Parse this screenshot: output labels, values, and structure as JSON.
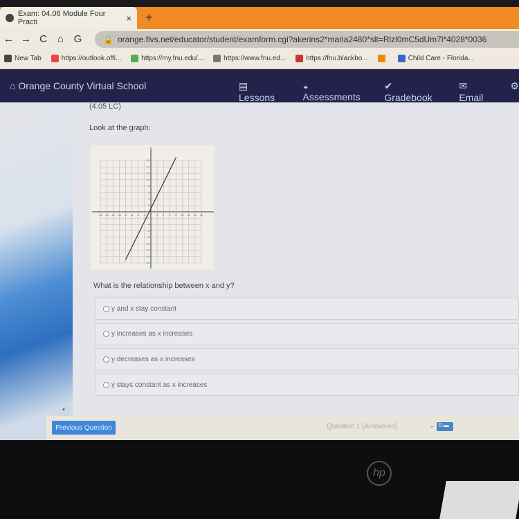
{
  "browser": {
    "tab_title": "Exam: 04.06 Module Four Practi",
    "new_tab": "+",
    "close": "×",
    "url": "orange.flvs.net/educator/student/examform.cgi?akerins2*maria2480*slt=Rlzl0mC5dUm7l*4028*0036",
    "bookmarks": [
      {
        "label": "New Tab",
        "color": "#444"
      },
      {
        "label": "https://outlook.offi...",
        "color": "#e44"
      },
      {
        "label": "https://my.fnu.edu/...",
        "color": "#5a5"
      },
      {
        "label": "https://www.fnu.ed...",
        "color": "#777"
      },
      {
        "label": "https://fnu.blackbo...",
        "color": "#c33"
      },
      {
        "label": "",
        "color": "#e80"
      },
      {
        "label": "Child Care - Florida...",
        "color": "#36c"
      }
    ]
  },
  "nav": {
    "brand": "⌂ Orange County Virtual School",
    "items": [
      "▤ Lessons",
      "◒ Assessments",
      "✔ Gradebook",
      "✉ Email",
      "⚙"
    ]
  },
  "question": {
    "id": "(4.05 LC)",
    "prompt": "Look at the graph:",
    "text": "What is the relationship between x and y?",
    "options": [
      "y and x stay constant",
      "y increases as x increases",
      "y decreases as x increases",
      "y stays constant as x increases"
    ]
  },
  "chart_data": {
    "type": "line",
    "xlabel": "x",
    "ylabel": "y",
    "xlim": [
      -16,
      16
    ],
    "ylim": [
      -16,
      16
    ],
    "grid": true,
    "tick_step": 2,
    "line": {
      "x": [
        -8,
        8
      ],
      "y": [
        -15,
        17
      ]
    }
  },
  "footer": {
    "prev_button": "Previous Question",
    "question_select": "Question 1 (Answered)",
    "flag": "0"
  },
  "monitor": {
    "logo": "hp"
  }
}
